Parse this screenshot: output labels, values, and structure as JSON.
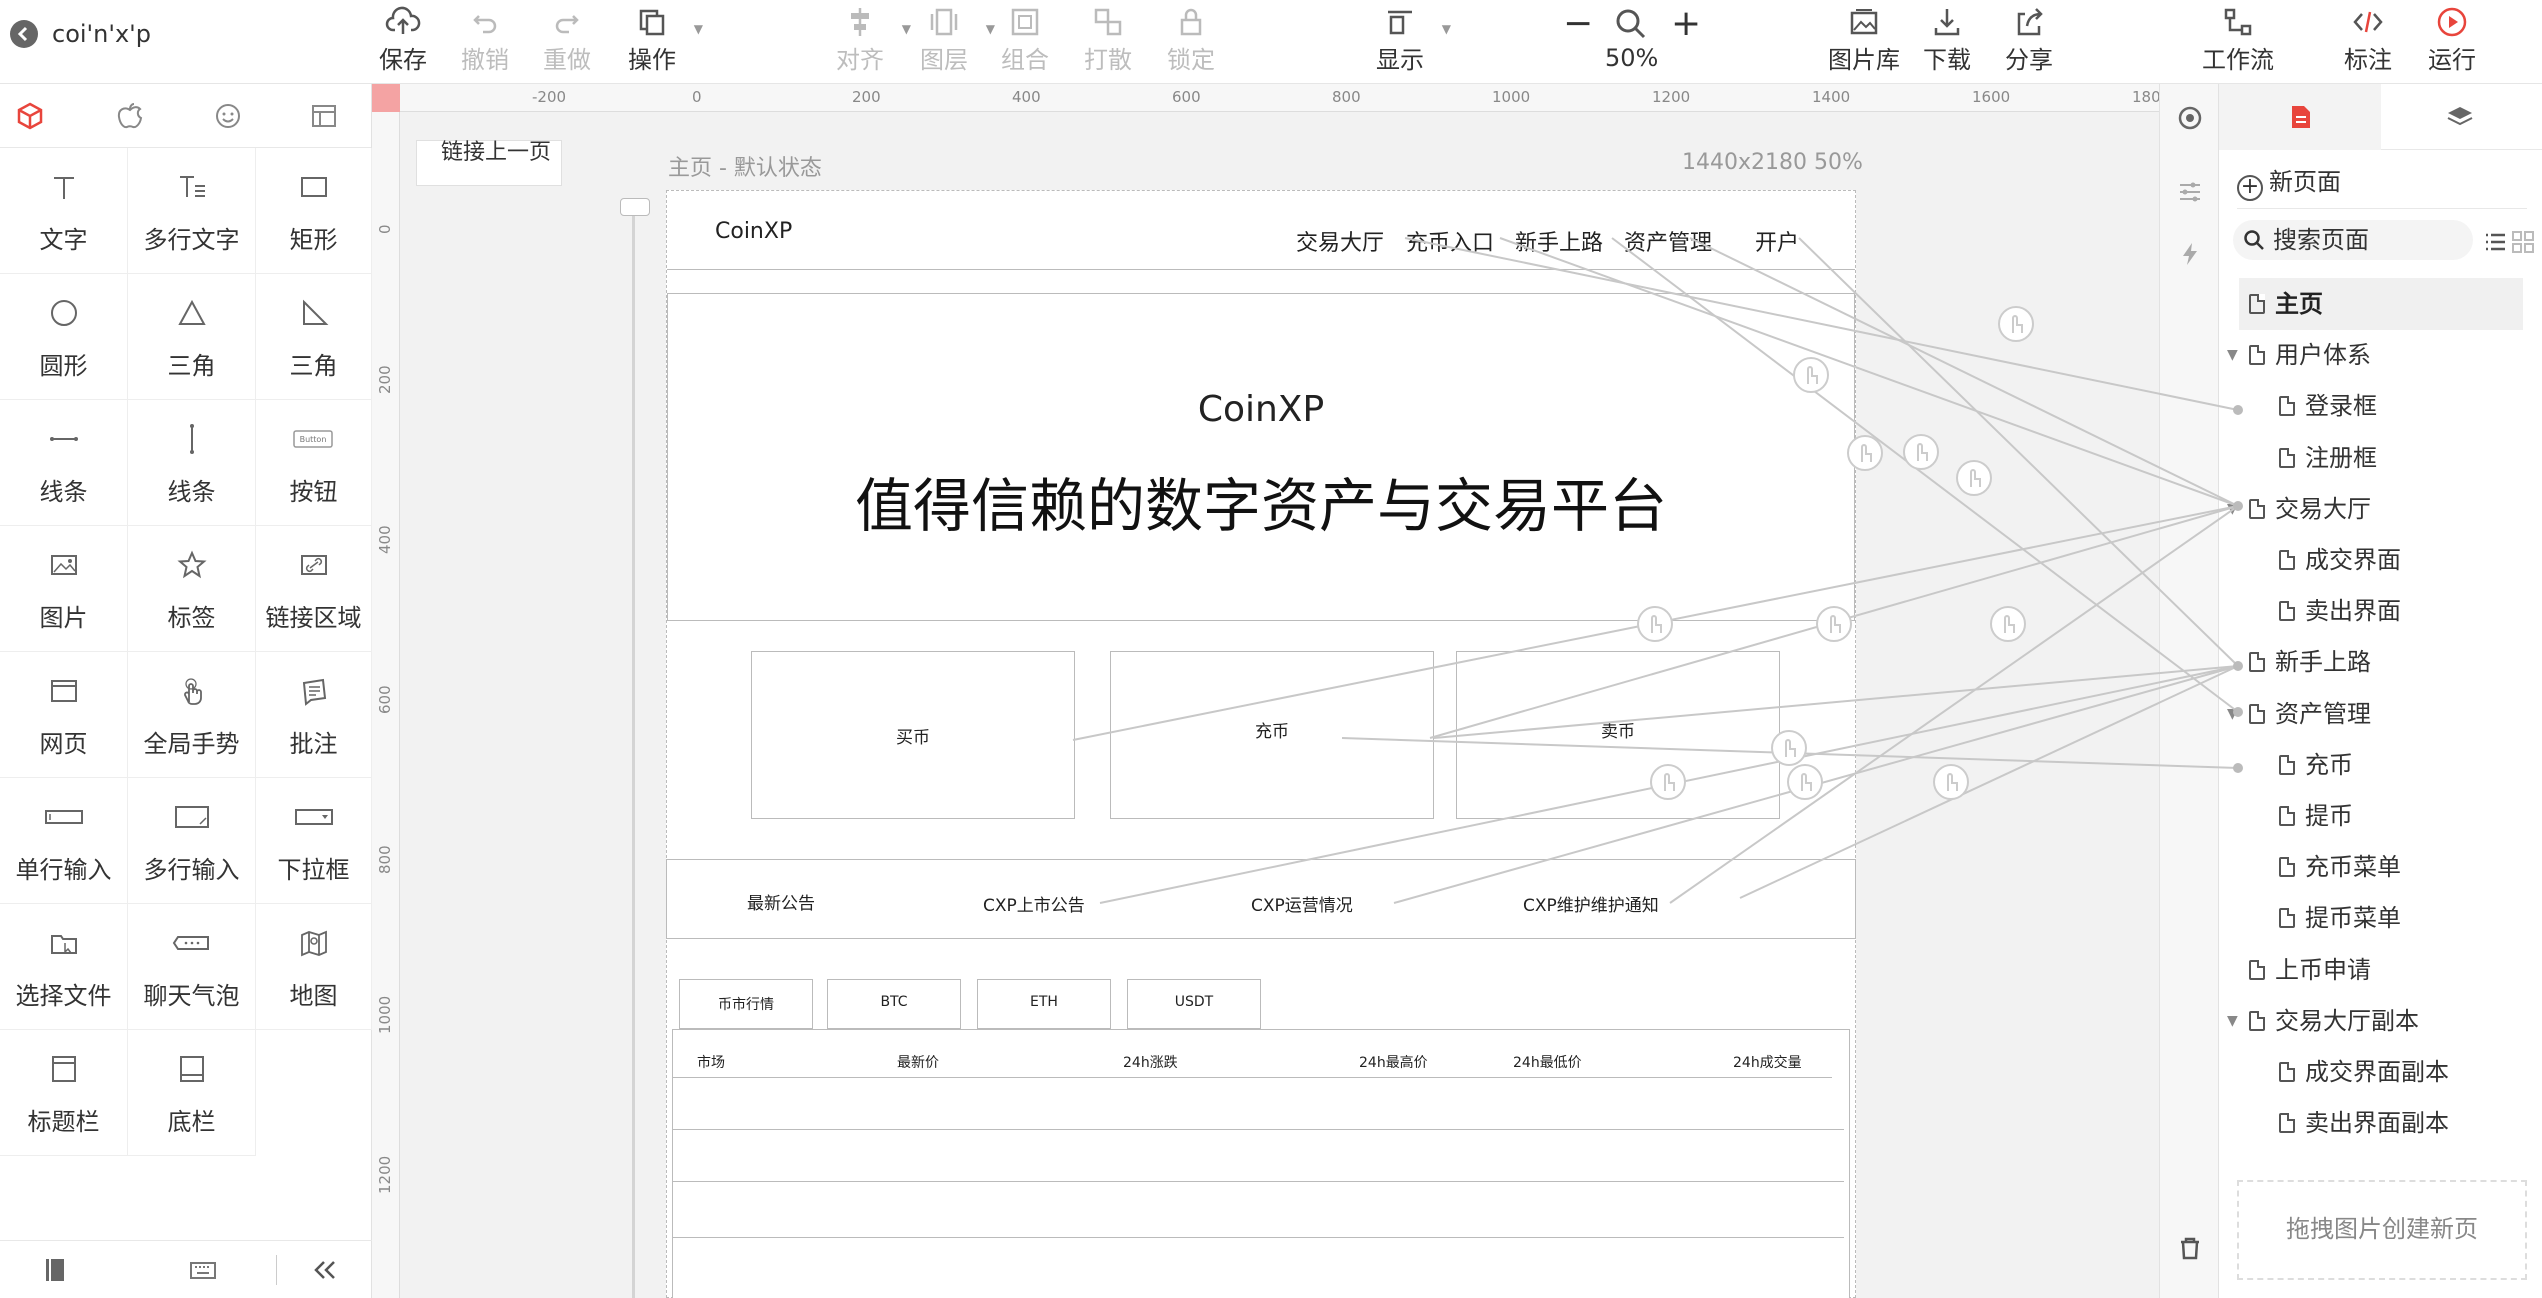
{
  "project": {
    "name": "coi'n'x'p"
  },
  "toolbar": {
    "save": "保存",
    "undo": "撤销",
    "redo": "重做",
    "operate": "操作",
    "align": "对齐",
    "layer": "图层",
    "group": "组合",
    "ungroup": "打散",
    "lock": "锁定",
    "display": "显示",
    "zoom_value": "50%",
    "gallery": "图片库",
    "download": "下载",
    "share": "分享",
    "workflow": "工作流",
    "annotate": "标注",
    "run": "运行"
  },
  "widgets": [
    {
      "label": "文字",
      "icon": "text-icon"
    },
    {
      "label": "多行文字",
      "icon": "multiline-text-icon"
    },
    {
      "label": "矩形",
      "icon": "rectangle-icon"
    },
    {
      "label": "圆形",
      "icon": "circle-icon"
    },
    {
      "label": "三角",
      "icon": "triangle-icon"
    },
    {
      "label": "三角",
      "icon": "right-triangle-icon"
    },
    {
      "label": "线条",
      "icon": "horizontal-line-icon"
    },
    {
      "label": "线条",
      "icon": "vertical-line-icon"
    },
    {
      "label": "按钮",
      "icon": "button-icon",
      "icon_text": "Button"
    },
    {
      "label": "图片",
      "icon": "image-icon"
    },
    {
      "label": "标签",
      "icon": "star-icon"
    },
    {
      "label": "链接区域",
      "icon": "link-area-icon"
    },
    {
      "label": "网页",
      "icon": "webpage-icon"
    },
    {
      "label": "全局手势",
      "icon": "gesture-icon"
    },
    {
      "label": "批注",
      "icon": "note-icon"
    },
    {
      "label": "单行输入",
      "icon": "single-input-icon"
    },
    {
      "label": "多行输入",
      "icon": "multi-input-icon"
    },
    {
      "label": "下拉框",
      "icon": "dropdown-icon"
    },
    {
      "label": "选择文件",
      "icon": "file-select-icon"
    },
    {
      "label": "聊天气泡",
      "icon": "chat-bubble-icon"
    },
    {
      "label": "地图",
      "icon": "map-icon"
    },
    {
      "label": "标题栏",
      "icon": "title-bar-icon"
    },
    {
      "label": "底栏",
      "icon": "bottom-bar-icon"
    }
  ],
  "canvas": {
    "link_button": "链接上一页",
    "page_label": "主页 - 默认状态",
    "page_size": "1440x2180 50%",
    "ruler_h": [
      "-200",
      "0",
      "200",
      "400",
      "600",
      "800",
      "1000",
      "1200",
      "1400",
      "1600",
      "180"
    ],
    "ruler_v": [
      "0",
      "200",
      "400",
      "600",
      "800",
      "1000",
      "1200"
    ]
  },
  "mockup": {
    "logo": "CoinXP",
    "nav": [
      "交易大厅",
      "充币入口",
      "新手上路",
      "资产管理",
      "开户"
    ],
    "hero_title": "CoinXP",
    "hero_subtitle": "值得信赖的数字资产与交易平台",
    "actions": [
      "买币",
      "充币",
      "卖币"
    ],
    "notices": [
      "最新公告",
      "CXP上市公告",
      "CXP运营情况",
      "CXP维护维护通知"
    ],
    "market_tabs": [
      "币市行情",
      "BTC",
      "ETH",
      "USDT"
    ],
    "table_headers": [
      "市场",
      "最新价",
      "24h涨跌",
      "24h最高价",
      "24h最低价",
      "24h成交量"
    ]
  },
  "pages": {
    "new_page": "新页面",
    "search_placeholder": "搜索页面",
    "tree": [
      {
        "label": "主页",
        "level": 0,
        "selected": true,
        "expandable": false
      },
      {
        "label": "用户体系",
        "level": 0,
        "selected": false,
        "expandable": true
      },
      {
        "label": "登录框",
        "level": 1,
        "selected": false,
        "expandable": false
      },
      {
        "label": "注册框",
        "level": 1,
        "selected": false,
        "expandable": false
      },
      {
        "label": "交易大厅",
        "level": 0,
        "selected": false,
        "expandable": true
      },
      {
        "label": "成交界面",
        "level": 1,
        "selected": false,
        "expandable": false
      },
      {
        "label": "卖出界面",
        "level": 1,
        "selected": false,
        "expandable": false
      },
      {
        "label": "新手上路",
        "level": 0,
        "selected": false,
        "expandable": false
      },
      {
        "label": "资产管理",
        "level": 0,
        "selected": false,
        "expandable": true
      },
      {
        "label": "充币",
        "level": 1,
        "selected": false,
        "expandable": false
      },
      {
        "label": "提币",
        "level": 1,
        "selected": false,
        "expandable": false
      },
      {
        "label": "充币菜单",
        "level": 1,
        "selected": false,
        "expandable": false
      },
      {
        "label": "提币菜单",
        "level": 1,
        "selected": false,
        "expandable": false
      },
      {
        "label": "上币申请",
        "level": 0,
        "selected": false,
        "expandable": false
      },
      {
        "label": "交易大厅副本",
        "level": 0,
        "selected": false,
        "expandable": true
      },
      {
        "label": "成交界面副本",
        "level": 1,
        "selected": false,
        "expandable": false
      },
      {
        "label": "卖出界面副本",
        "level": 1,
        "selected": false,
        "expandable": false
      }
    ],
    "drop_hint": "拖拽图片创建新页"
  },
  "colors": {
    "accent": "#e8453c",
    "link_line": "#c8c8c8"
  }
}
